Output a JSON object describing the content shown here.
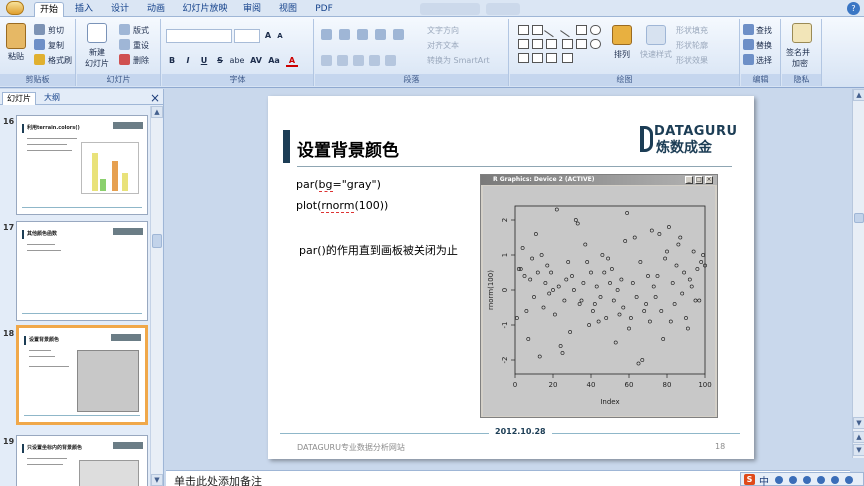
{
  "ribbon_tabs": [
    "开始",
    "插入",
    "设计",
    "动画",
    "幻灯片放映",
    "审阅",
    "视图",
    "PDF"
  ],
  "clipboard": {
    "paste_label": "粘贴",
    "cut_label": "剪切",
    "copy_label": "复制",
    "format_painter_label": "格式刷",
    "group_label": "剪贴板"
  },
  "slides_group": {
    "new_slide_label_1": "新建",
    "new_slide_label_2": "幻灯片",
    "layout_label": "版式",
    "reset_label": "重设",
    "delete_label": "删除",
    "group_label": "幻灯片"
  },
  "font_group": {
    "font_size_a_plus": "A",
    "font_size_a_minus": "A",
    "bold": "B",
    "italic": "I",
    "underline": "U",
    "strike": "S",
    "shadow": "abe",
    "spacing": "AV",
    "case": "Aa",
    "color": "A",
    "group_label": "字体"
  },
  "paragraph_group": {
    "text_direction_label": "文字方向",
    "align_text_label": "对齐文本",
    "smartart_label": "转换为 SmartArt",
    "group_label": "段落"
  },
  "drawing_group": {
    "arrange_label": "排列",
    "quick_styles_label": "快速样式",
    "shape_fill_label": "形状填充",
    "shape_outline_label": "形状轮廓",
    "shape_effects_label": "形状效果",
    "group_label": "绘图"
  },
  "editing_group": {
    "find_label": "查找",
    "replace_label": "替换",
    "select_label": "选择",
    "group_label": "编辑"
  },
  "privacy_group": {
    "sign_label_1": "签名并",
    "sign_label_2": "加密",
    "group_label": "隐私"
  },
  "pane": {
    "tab_slides": "幻灯片",
    "tab_outline": "大纲",
    "close": "×",
    "thumbnails": [
      {
        "number": "16",
        "title": "利用terrain.colors()"
      },
      {
        "number": "17",
        "title": "其他颜色函数"
      },
      {
        "number": "18",
        "title": "设置背景颜色"
      },
      {
        "number": "19",
        "title": "只设置坐标内的背景颜色"
      }
    ]
  },
  "slide": {
    "title": "设置背景颜色",
    "logo_line1": "DATAGURU",
    "logo_line2": "炼数成金",
    "code_line1_a": "par(",
    "code_line1_b": "bg",
    "code_line1_c": "=\"gray\")",
    "code_line2_a": "plot(",
    "code_line2_b": "rnorm",
    "code_line2_c": "(100))",
    "note": "par()的作用直到画板被关闭为止",
    "date": "2012.10.28",
    "footer_text": "DATAGURU专业数据分析网站",
    "page_number": "18"
  },
  "r_window": {
    "title": "R Graphics: Device 2 (ACTIVE)",
    "minimize": "_",
    "maximize": "□",
    "close": "×"
  },
  "chart_data": {
    "type": "scatter",
    "title": "",
    "xlabel": "Index",
    "ylabel": "rnorm(100)",
    "xlim": [
      0,
      100
    ],
    "ylim": [
      -2.4,
      2.4
    ],
    "x_ticks": [
      0,
      20,
      40,
      60,
      80,
      100
    ],
    "y_ticks": [
      -2,
      -1,
      0,
      1,
      2
    ],
    "background": "#c8c8c8",
    "x": [
      1,
      2,
      3,
      4,
      5,
      6,
      7,
      8,
      9,
      10,
      11,
      12,
      13,
      14,
      15,
      16,
      17,
      18,
      19,
      20,
      21,
      22,
      23,
      24,
      25,
      26,
      27,
      28,
      29,
      30,
      31,
      32,
      33,
      34,
      35,
      36,
      37,
      38,
      39,
      40,
      41,
      42,
      43,
      44,
      45,
      46,
      47,
      48,
      49,
      50,
      51,
      52,
      53,
      54,
      55,
      56,
      57,
      58,
      59,
      60,
      61,
      62,
      63,
      64,
      65,
      66,
      67,
      68,
      69,
      70,
      71,
      72,
      73,
      74,
      75,
      76,
      77,
      78,
      79,
      80,
      81,
      82,
      83,
      84,
      85,
      86,
      87,
      88,
      89,
      90,
      91,
      92,
      93,
      94,
      95,
      96,
      97,
      98,
      99,
      100
    ],
    "y": [
      -0.8,
      0.6,
      0.6,
      1.2,
      0.4,
      -0.6,
      -1.4,
      0.3,
      0.9,
      -0.2,
      1.6,
      0.5,
      -1.9,
      1.0,
      -0.5,
      0.2,
      0.7,
      -0.1,
      0.5,
      0.0,
      -0.7,
      2.3,
      0.1,
      -1.6,
      -1.8,
      -0.3,
      0.3,
      0.8,
      -1.2,
      0.4,
      0.0,
      2.0,
      1.9,
      -0.4,
      -0.3,
      0.2,
      1.3,
      0.8,
      -1.0,
      0.5,
      -0.6,
      -0.4,
      0.1,
      -0.9,
      -0.2,
      1.0,
      0.5,
      -0.8,
      0.9,
      0.2,
      0.6,
      -0.3,
      -1.5,
      0.0,
      -0.7,
      0.3,
      -0.5,
      1.4,
      2.2,
      -1.1,
      -0.8,
      0.2,
      1.5,
      -0.2,
      -2.1,
      0.8,
      -2.0,
      -0.6,
      -0.4,
      0.4,
      -0.9,
      1.7,
      0.1,
      -0.2,
      0.4,
      1.6,
      -0.6,
      -1.4,
      0.9,
      1.1,
      1.8,
      -0.9,
      0.2,
      -0.4,
      0.7,
      1.3,
      1.5,
      -0.1,
      0.5,
      -0.8,
      -1.1,
      0.3,
      0.1,
      1.1,
      -0.3,
      0.6,
      -0.3,
      0.8,
      1.0,
      0.7
    ]
  },
  "notes_placeholder": "单击此处添加备注",
  "status": {
    "ime": "中"
  }
}
